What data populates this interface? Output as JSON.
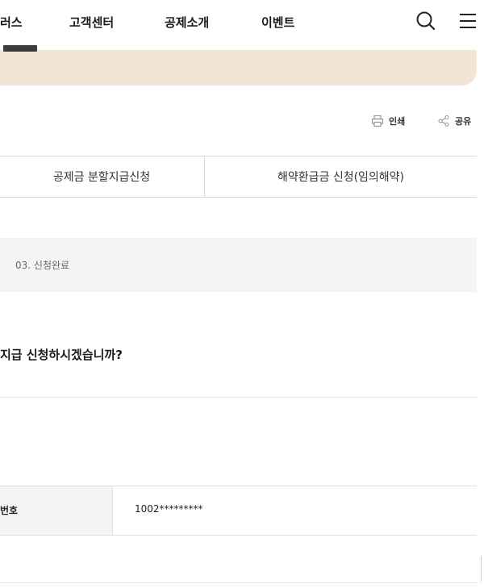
{
  "header": {
    "nav": [
      "러스",
      "고객센터",
      "공제소개",
      "이벤트"
    ]
  },
  "utility": {
    "print_label": "인쇄",
    "share_label": "공유"
  },
  "tabs": [
    {
      "label": "공제금 분할지급신청"
    },
    {
      "label": "해약환급금 신청(임의해약)"
    }
  ],
  "steps": {
    "current_label": "03. 신청완료"
  },
  "content": {
    "question": "지급 신청하시겠습니까?"
  },
  "info_table": {
    "rows": [
      {
        "label": "번호",
        "value": "1002*********"
      }
    ]
  }
}
